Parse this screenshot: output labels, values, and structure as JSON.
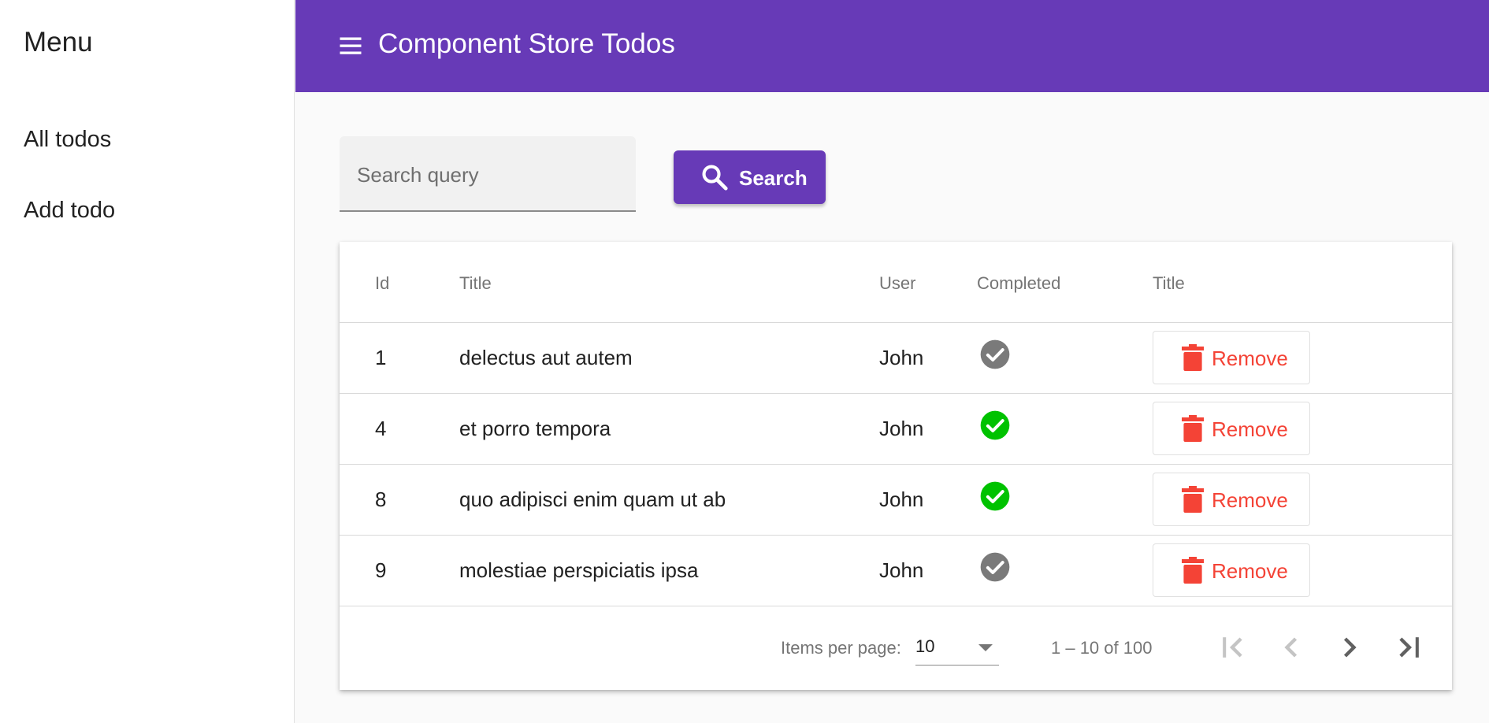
{
  "sidebar": {
    "title": "Menu",
    "items": [
      {
        "label": "All todos"
      },
      {
        "label": "Add todo"
      }
    ]
  },
  "topbar": {
    "menu_icon": "menu-icon",
    "title": "Component Store Todos"
  },
  "search": {
    "placeholder": "Search query",
    "value": "",
    "button_label": "Search",
    "button_icon": "search-icon"
  },
  "table": {
    "columns": [
      "Id",
      "Title",
      "User",
      "Completed",
      "Title"
    ],
    "rows": [
      {
        "id": "1",
        "title": "delectus aut autem",
        "user": "John",
        "completed": false,
        "action": "Remove"
      },
      {
        "id": "4",
        "title": "et porro tempora",
        "user": "John",
        "completed": true,
        "action": "Remove"
      },
      {
        "id": "8",
        "title": "quo adipisci enim quam ut ab",
        "user": "John",
        "completed": true,
        "action": "Remove"
      },
      {
        "id": "9",
        "title": "molestiae perspiciatis ipsa",
        "user": "John",
        "completed": false,
        "action": "Remove"
      }
    ]
  },
  "paginator": {
    "items_per_page_label": "Items per page:",
    "items_per_page": "10",
    "range": "1 – 10 of 100",
    "buttons": [
      "first-page-icon",
      "previous-page-icon",
      "next-page-icon",
      "last-page-icon"
    ]
  },
  "colors": {
    "primary": "#673ab7",
    "warn": "#f44336",
    "completed": "#00c200",
    "not_completed": "#7a7a7a"
  }
}
